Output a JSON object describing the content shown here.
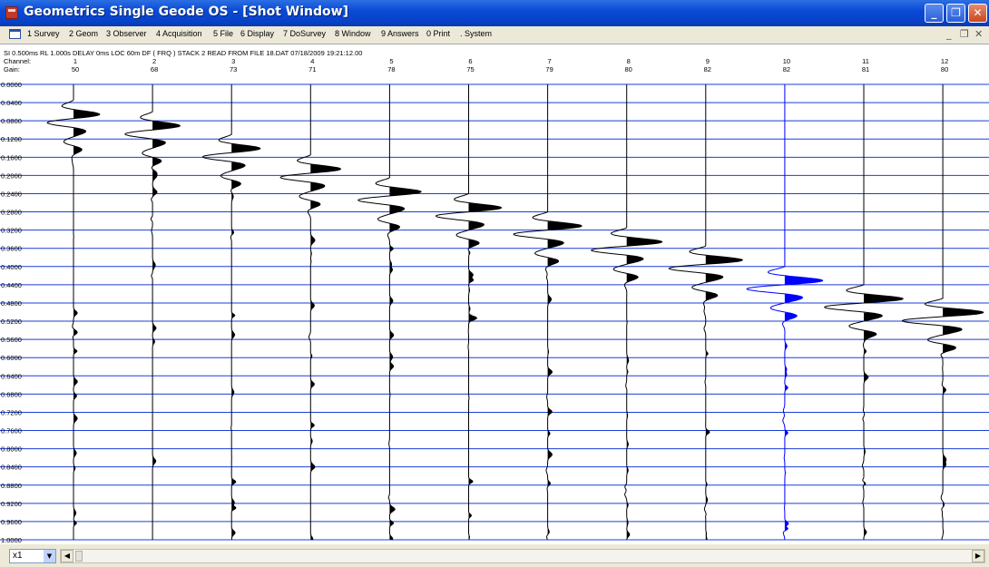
{
  "window": {
    "title": "Geometrics Single Geode OS - [Shot Window]",
    "minimize_label": "_",
    "maximize_label": "❐",
    "close_label": "✕"
  },
  "menu": {
    "items": [
      "1 Survey",
      "2 Geom",
      "3 Observer",
      "4 Acquisition",
      "5 File",
      "6 Display",
      "7 DoSurvey",
      "8 Window",
      "9 Answers",
      "0 Print",
      ". System"
    ],
    "mdi_minimize": "_",
    "mdi_restore": "❐",
    "mdi_close": "✕"
  },
  "header": {
    "info": "SI 0.500ms   RL 1.000s   DELAY 0ms   LOC 60m   DF ( FRQ )   STACK 2     READ FROM FILE 18.DAT 07/18/2009 19:21:12.00",
    "channel_label": "Channel:",
    "gain_label": "Gain:",
    "channels": [
      "1",
      "2",
      "3",
      "4",
      "5",
      "6",
      "7",
      "8",
      "9",
      "10",
      "11",
      "12"
    ],
    "gains": [
      "50",
      "68",
      "73",
      "71",
      "78",
      "75",
      "79",
      "80",
      "82",
      "82",
      "81",
      "80"
    ]
  },
  "time_axis": [
    "0.0000",
    "0.0400",
    "0.0800",
    "0.1200",
    "0.1600",
    "0.2000",
    "0.2400",
    "0.2800",
    "0.3200",
    "0.3600",
    "0.4000",
    "0.4400",
    "0.4800",
    "0.5200",
    "0.5600",
    "0.6000",
    "0.6400",
    "0.6800",
    "0.7200",
    "0.7600",
    "0.8000",
    "0.8400",
    "0.8800",
    "0.9200",
    "0.9600",
    "1.0000"
  ],
  "traces": {
    "first_break_times": [
      0.055,
      0.08,
      0.13,
      0.175,
      0.225,
      0.26,
      0.3,
      0.335,
      0.375,
      0.42,
      0.46,
      0.49
    ],
    "selected_channel": 10,
    "trace_color": "#000000",
    "selected_color": "#0000ff",
    "gridline_color": "#1a3fd8"
  },
  "statusbar": {
    "zoom_value": "x1"
  }
}
